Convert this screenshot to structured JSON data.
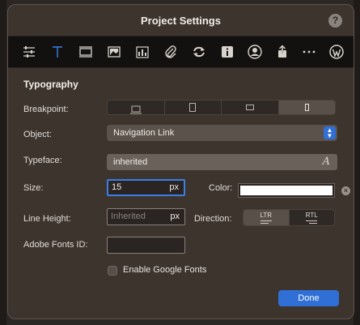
{
  "window": {
    "title": "Project Settings",
    "help_label": "?"
  },
  "toolbar": {
    "items": [
      {
        "icon": "sliders-icon"
      },
      {
        "icon": "text-icon",
        "active": true,
        "accent": "#3b7fe6"
      },
      {
        "icon": "banner-icon"
      },
      {
        "icon": "image-gallery-icon"
      },
      {
        "icon": "chart-icon"
      },
      {
        "icon": "paperclip-icon"
      },
      {
        "icon": "refresh-icon"
      },
      {
        "icon": "info-icon"
      },
      {
        "icon": "user-icon"
      },
      {
        "icon": "share-icon"
      },
      {
        "icon": "more-icon"
      },
      {
        "icon": "wordpress-icon"
      }
    ]
  },
  "typography": {
    "section_title": "Typography",
    "breakpoint": {
      "label": "Breakpoint:",
      "options": [
        "desktop-icon",
        "tablet-portrait-icon",
        "tablet-landscape-icon",
        "phone-icon"
      ],
      "selected_index": 3
    },
    "object": {
      "label": "Object:",
      "value": "Navigation Link"
    },
    "typeface": {
      "label": "Typeface:",
      "value": "inherited",
      "icon_glyph": "A"
    },
    "size": {
      "label": "Size:",
      "value": "15",
      "unit": "px"
    },
    "color": {
      "label": "Color:",
      "value": "#ffffff",
      "clear_glyph": "×"
    },
    "line_height": {
      "label": "Line Height:",
      "placeholder": "Inherited",
      "unit": "px"
    },
    "direction": {
      "label": "Direction:",
      "options": [
        "LTR",
        "RTL"
      ],
      "selected": "LTR"
    },
    "adobe_fonts": {
      "label": "Adobe Fonts ID:",
      "value": ""
    },
    "google_fonts": {
      "label": "Enable Google Fonts",
      "checked": false
    }
  },
  "footer": {
    "done_label": "Done"
  },
  "colors": {
    "accent": "#2f6fd6",
    "window_bg": "#3d342e",
    "toolbar_bg": "#121110"
  }
}
